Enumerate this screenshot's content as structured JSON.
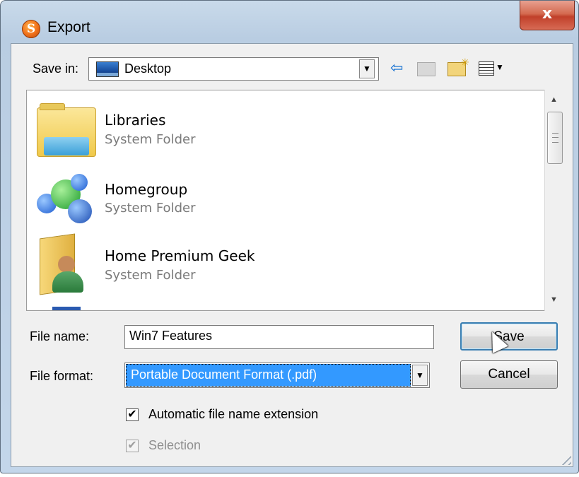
{
  "window": {
    "title": "Export",
    "close_label": "x"
  },
  "save_in": {
    "label": "Save in:",
    "value": "Desktop"
  },
  "toolbar": {
    "icons": [
      "back-arrow-icon",
      "up-folder-icon",
      "new-folder-icon",
      "view-menu-icon"
    ]
  },
  "file_list": {
    "items": [
      {
        "name": "Libraries",
        "type": "System Folder",
        "icon": "libraries-folder-icon"
      },
      {
        "name": "Homegroup",
        "type": "System Folder",
        "icon": "homegroup-icon"
      },
      {
        "name": "Home Premium Geek",
        "type": "System Folder",
        "icon": "user-folder-icon"
      }
    ]
  },
  "file_name": {
    "label": "File name:",
    "value": "Win7 Features"
  },
  "file_format": {
    "label": "File format:",
    "value": "Portable Document Format (.pdf)"
  },
  "buttons": {
    "save": "Save",
    "cancel": "Cancel"
  },
  "options": {
    "auto_extension": {
      "label": "Automatic file name extension",
      "checked": true,
      "enabled": true
    },
    "selection": {
      "label": "Selection",
      "checked": true,
      "enabled": false
    }
  },
  "colors": {
    "selection_highlight": "#3399ff",
    "close_button": "#c1402a",
    "frame": "#c3d6ea"
  }
}
